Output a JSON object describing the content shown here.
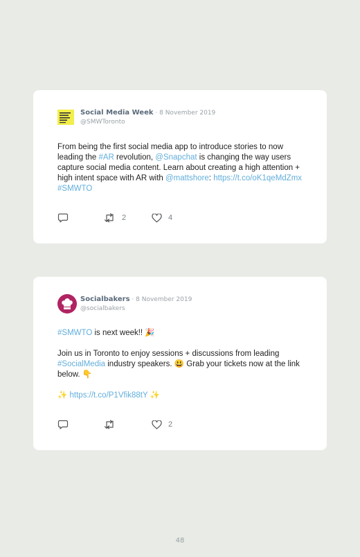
{
  "posts": [
    {
      "author": "Social Media Week",
      "date": " · 8 November 2019",
      "handle": "@SMWToronto",
      "avatar_icon": "social-media-week-logo",
      "body": [
        {
          "t": "From being the first social media app to introduce stories to now leading the ",
          "c": "text"
        },
        {
          "t": "#AR",
          "c": "link"
        },
        {
          "t": " revolution, ",
          "c": "text"
        },
        {
          "t": "@Snapchat",
          "c": "link"
        },
        {
          "t": " is changing the way users capture social media content. Learn about creating a high attention + high intent space with AR with ",
          "c": "text"
        },
        {
          "t": "@mattshore",
          "c": "link"
        },
        {
          "t": ": ",
          "c": "text"
        },
        {
          "t": "https://t.co/oK1qeMdZmx",
          "c": "link"
        },
        {
          "t": " ",
          "c": "text"
        },
        {
          "t": "#SMWTO",
          "c": "link"
        }
      ],
      "retweets": "2",
      "likes": "4"
    },
    {
      "author": "Socialbakers",
      "date": " · 8 November 2019",
      "handle": "@socialbakers",
      "avatar_icon": "socialbakers-logo",
      "p1": [
        {
          "t": "#SMWTO",
          "c": "link"
        },
        {
          "t": " is next week!! 🎉",
          "c": "text"
        }
      ],
      "p2": [
        {
          "t": "Join us in Toronto to enjoy sessions + discussions from leading ",
          "c": "text"
        },
        {
          "t": "#SocialMedia",
          "c": "link"
        },
        {
          "t": " industry speakers. 😃 Grab your tickets now at the link below. 👇",
          "c": "text"
        }
      ],
      "p3": [
        {
          "t": "✨ ",
          "c": "text"
        },
        {
          "t": "https://t.co/P1Vfik88tY",
          "c": "link"
        },
        {
          "t": " ✨",
          "c": "text"
        }
      ],
      "likes": "2"
    }
  ],
  "page_number": "48",
  "colors": {
    "background": "#e9ebe6",
    "link": "#62aedb",
    "author": "#5a6a7a",
    "socialbakers_brand": "#b02462"
  }
}
